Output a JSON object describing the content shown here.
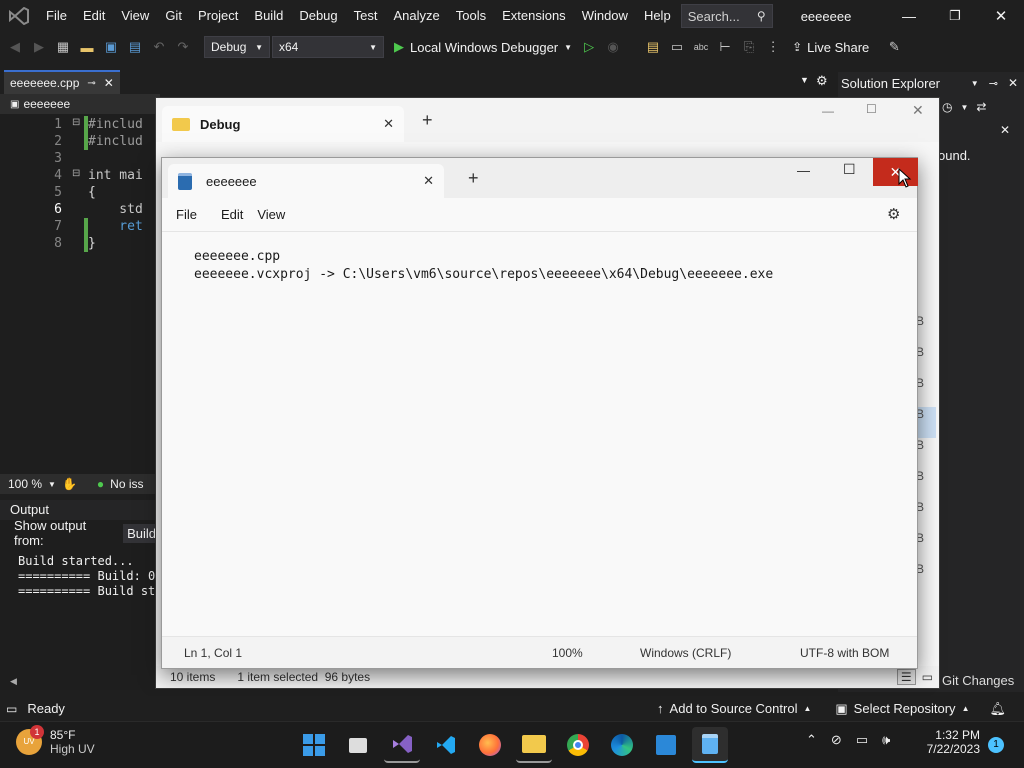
{
  "vs": {
    "menu": [
      "File",
      "Edit",
      "View",
      "Git",
      "Project",
      "Build",
      "Debug",
      "Test",
      "Analyze",
      "Tools",
      "Extensions",
      "Window",
      "Help"
    ],
    "search_placeholder": "Search...",
    "solution_name": "eeeeeee",
    "toolbar": {
      "config": "Debug",
      "platform": "x64",
      "run_label": "Local Windows Debugger",
      "live_share": "Live Share"
    },
    "doc_tab": "eeeeeee.cpp",
    "nav_scope": "eeeeeee",
    "code": {
      "line_numbers": [
        "1",
        "2",
        "3",
        "4",
        "5",
        "6",
        "7",
        "8"
      ],
      "lines": [
        "#includ",
        "#includ",
        "",
        "int mai",
        "{",
        "    std",
        "    ret",
        "}"
      ]
    },
    "zoom": "100 %",
    "issues": "No iss",
    "output": {
      "title": "Output",
      "show_from_label": "Show output from:",
      "source": "Build",
      "lines": [
        "Build started...",
        "========== Build: 0",
        "========== Build sta"
      ]
    },
    "solution_explorer": {
      "title": "Solution Explorer",
      "message": "ound."
    },
    "status": {
      "ready": "Ready",
      "add_source_control": "Add to Source Control",
      "select_repo": "Select Repository",
      "git_changes": "Git Changes"
    }
  },
  "explorer": {
    "tab_title": "Debug",
    "item_count": "10 items",
    "selection": "1 item selected  96 bytes",
    "size_suffixes": [
      "B",
      "B",
      "B",
      "B",
      "B",
      "B",
      "B",
      "B",
      "B"
    ]
  },
  "notepad": {
    "tab_title": "eeeeeee",
    "menu": [
      "File",
      "Edit",
      "View"
    ],
    "content_lines": [
      "eeeeeee.cpp",
      "eeeeeee.vcxproj -> C:\\Users\\vm6\\source\\repos\\eeeeeee\\x64\\Debug\\eeeeeee.exe"
    ],
    "status": {
      "position": "Ln 1, Col 1",
      "zoom": "100%",
      "line_ending": "Windows (CRLF)",
      "encoding": "UTF-8 with BOM"
    }
  },
  "taskbar": {
    "weather": {
      "temp": "85°F",
      "desc": "High UV",
      "badge": "1"
    },
    "time": "1:32 PM",
    "date": "7/22/2023",
    "notif_count": "1"
  },
  "colors": {
    "accent": "#3a6fd0",
    "vs_purple": "#8661c5",
    "close_red": "#c42b1c"
  }
}
